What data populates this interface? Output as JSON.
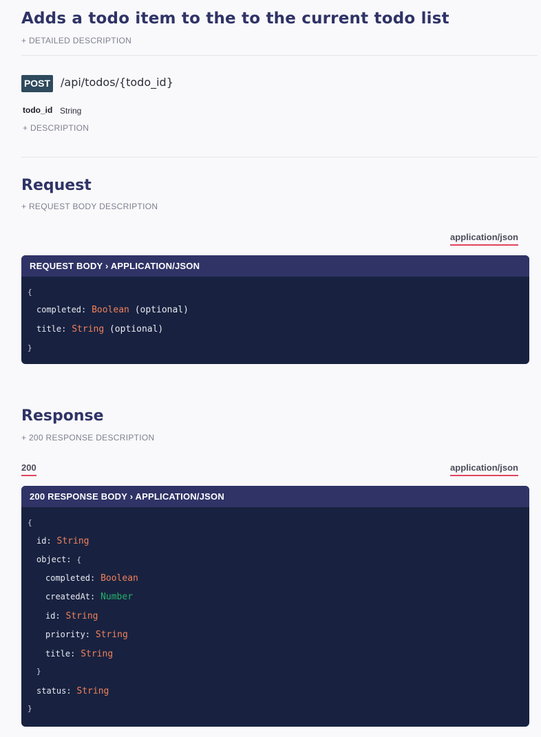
{
  "title": "Adds a todo item to the to the current todo list",
  "detailed_description_toggle": "+ DETAILED DESCRIPTION",
  "endpoint": {
    "method": "POST",
    "path": "/api/todos/{todo_id}",
    "param": {
      "name": "todo_id",
      "type": "String"
    },
    "param_description_toggle": "+ DESCRIPTION"
  },
  "request": {
    "heading": "Request",
    "body_description_toggle": "+ REQUEST BODY DESCRIPTION",
    "content_type_tab": "application/json",
    "panel_header": "REQUEST BODY  ›  APPLICATION/JSON",
    "open_brace": "{",
    "close_brace": "}",
    "fields": [
      {
        "key": "completed:",
        "type": "Boolean",
        "note": "(optional)"
      },
      {
        "key": "title:",
        "type": "String",
        "note": "(optional)"
      }
    ]
  },
  "response": {
    "heading": "Response",
    "description_toggle": "+ 200 RESPONSE DESCRIPTION",
    "status_tab": "200",
    "content_type_tab": "application/json",
    "panel_header": "200 RESPONSE BODY  ›  APPLICATION/JSON",
    "open_brace": "{",
    "close_brace": "}",
    "fields": {
      "id": {
        "key": "id:",
        "type": "String"
      },
      "object": {
        "key": "object:",
        "open_brace": "{",
        "close_brace": "}",
        "fields": [
          {
            "key": "completed:",
            "type": "Boolean"
          },
          {
            "key": "createdAt:",
            "type": "Number"
          },
          {
            "key": "id:",
            "type": "String"
          },
          {
            "key": "priority:",
            "type": "String"
          },
          {
            "key": "title:",
            "type": "String"
          }
        ]
      },
      "status": {
        "key": "status:",
        "type": "String"
      }
    }
  },
  "colors": {
    "heading": "#2f3366",
    "panel_bg": "#182240",
    "panel_header_bg": "#2f3366",
    "type_string": "#f0805a",
    "type_number": "#25b26a",
    "tab_underline": "#e0455d",
    "method_badge": "#2e4a5c"
  }
}
